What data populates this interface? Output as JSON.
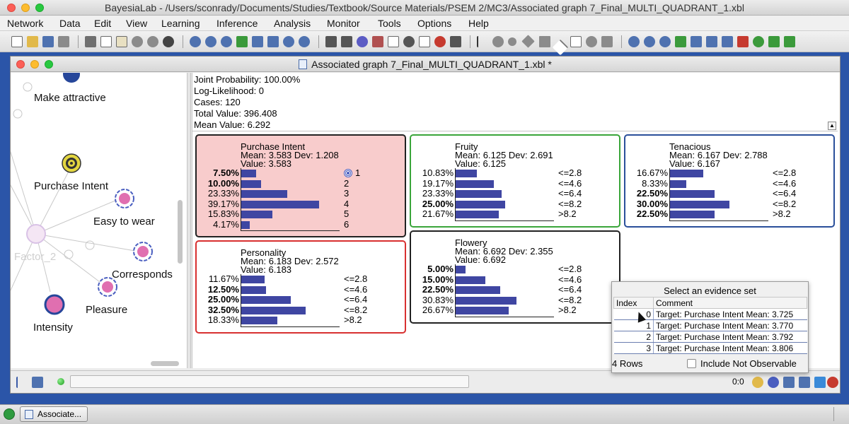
{
  "app": {
    "window_title": "BayesiaLab - /Users/sconrady/Documents/Studies/Textbook/Source Materials/PSEM 2/MC3/Associated graph 7_Final_MULTI_QUADRANT_1.xbl",
    "menus": [
      "Network",
      "Data",
      "Edit",
      "View",
      "Learning",
      "Inference",
      "Analysis",
      "Monitor",
      "Tools",
      "Options",
      "Help"
    ]
  },
  "document": {
    "title": "Associated graph 7_Final_MULTI_QUADRANT_1.xbl *"
  },
  "graph": {
    "nodes": [
      {
        "id": "make-attractive",
        "label": "Make attractive"
      },
      {
        "id": "purchase-intent",
        "label": "Purchase Intent"
      },
      {
        "id": "easy-to-wear",
        "label": "Easy to wear"
      },
      {
        "id": "factor-2",
        "label": "Factor_2"
      },
      {
        "id": "corresponds",
        "label": "Corresponds"
      },
      {
        "id": "pleasure",
        "label": "Pleasure"
      },
      {
        "id": "intensity",
        "label": "Intensity"
      }
    ]
  },
  "stats": {
    "joint_probability": "Joint Probability: 100.00%",
    "log_likelihood": "Log-Likelihood: 0",
    "cases": "Cases: 120",
    "total_value": "Total Value: 396.408",
    "mean_value": "Mean Value: 6.292"
  },
  "monitors": {
    "purchase_intent": {
      "title": "Purchase Intent",
      "mean": "Mean: 3.583 Dev: 1.208",
      "value": "Value: 3.583",
      "border": "#222222",
      "background": "#f8cccc",
      "rows": [
        {
          "pct": "7.50%",
          "p": 0.075,
          "state": "1",
          "bold": true
        },
        {
          "pct": "10.00%",
          "p": 0.1,
          "state": "2",
          "bold": true
        },
        {
          "pct": "23.33%",
          "p": 0.2333,
          "state": "3",
          "bold": false
        },
        {
          "pct": "39.17%",
          "p": 0.3917,
          "state": "4",
          "bold": false
        },
        {
          "pct": "15.83%",
          "p": 0.1583,
          "state": "5",
          "bold": false
        },
        {
          "pct": "4.17%",
          "p": 0.0417,
          "state": "6",
          "bold": false
        }
      ]
    },
    "fruity": {
      "title": "Fruity",
      "mean": "Mean: 6.125 Dev: 2.691",
      "value": "Value: 6.125",
      "border": "#3aa53a",
      "background": "#ffffff",
      "rows": [
        {
          "pct": "10.83%",
          "p": 0.1083,
          "state": "<=2.8",
          "bold": false
        },
        {
          "pct": "19.17%",
          "p": 0.1917,
          "state": "<=4.6",
          "bold": false
        },
        {
          "pct": "23.33%",
          "p": 0.2333,
          "state": "<=6.4",
          "bold": false
        },
        {
          "pct": "25.00%",
          "p": 0.25,
          "state": "<=8.2",
          "bold": true
        },
        {
          "pct": "21.67%",
          "p": 0.2167,
          "state": ">8.2",
          "bold": false
        }
      ]
    },
    "tenacious": {
      "title": "Tenacious",
      "mean": "Mean: 6.167 Dev: 2.788",
      "value": "Value: 6.167",
      "border": "#2a4f9a",
      "background": "#ffffff",
      "rows": [
        {
          "pct": "16.67%",
          "p": 0.1667,
          "state": "<=2.8",
          "bold": false
        },
        {
          "pct": "8.33%",
          "p": 0.0833,
          "state": "<=4.6",
          "bold": false
        },
        {
          "pct": "22.50%",
          "p": 0.225,
          "state": "<=6.4",
          "bold": true
        },
        {
          "pct": "30.00%",
          "p": 0.3,
          "state": "<=8.2",
          "bold": true
        },
        {
          "pct": "22.50%",
          "p": 0.225,
          "state": ">8.2",
          "bold": true
        }
      ]
    },
    "personality": {
      "title": "Personality",
      "mean": "Mean: 6.183 Dev: 2.572",
      "value": "Value: 6.183",
      "border": "#d83030",
      "background": "#ffffff",
      "rows": [
        {
          "pct": "11.67%",
          "p": 0.1167,
          "state": "<=2.8",
          "bold": false
        },
        {
          "pct": "12.50%",
          "p": 0.125,
          "state": "<=4.6",
          "bold": true
        },
        {
          "pct": "25.00%",
          "p": 0.25,
          "state": "<=6.4",
          "bold": true
        },
        {
          "pct": "32.50%",
          "p": 0.325,
          "state": "<=8.2",
          "bold": true
        },
        {
          "pct": "18.33%",
          "p": 0.1833,
          "state": ">8.2",
          "bold": false
        }
      ]
    },
    "flowery": {
      "title": "Flowery",
      "mean": "Mean: 6.692 Dev: 2.355",
      "value": "Value: 6.692",
      "border": "#222222",
      "background": "#ffffff",
      "rows": [
        {
          "pct": "5.00%",
          "p": 0.05,
          "state": "<=2.8",
          "bold": true
        },
        {
          "pct": "15.00%",
          "p": 0.15,
          "state": "<=4.6",
          "bold": true
        },
        {
          "pct": "22.50%",
          "p": 0.225,
          "state": "<=6.4",
          "bold": true
        },
        {
          "pct": "30.83%",
          "p": 0.3083,
          "state": "<=8.2",
          "bold": false
        },
        {
          "pct": "26.67%",
          "p": 0.2667,
          "state": ">8.2",
          "bold": false
        }
      ]
    }
  },
  "evidence_popup": {
    "title": "Select an evidence set",
    "columns": [
      "Index",
      "Comment"
    ],
    "rows": [
      {
        "index": "0",
        "comment": "Target: Purchase Intent Mean: 3.725"
      },
      {
        "index": "1",
        "comment": "Target: Purchase Intent Mean: 3.770"
      },
      {
        "index": "2",
        "comment": "Target: Purchase Intent Mean: 3.792"
      },
      {
        "index": "3",
        "comment": "Target: Purchase Intent Mean: 3.806"
      }
    ],
    "row_count": "4 Rows",
    "include_not_observable_label": "Include Not Observable",
    "include_not_observable_checked": false
  },
  "statusbar": {
    "count": "0:0"
  },
  "taskbar": {
    "task_label": "Associate..."
  },
  "colors": {
    "bar": "#3f46a2",
    "node_fill": "#e06fb0",
    "target_yellow": "#e3d640"
  }
}
